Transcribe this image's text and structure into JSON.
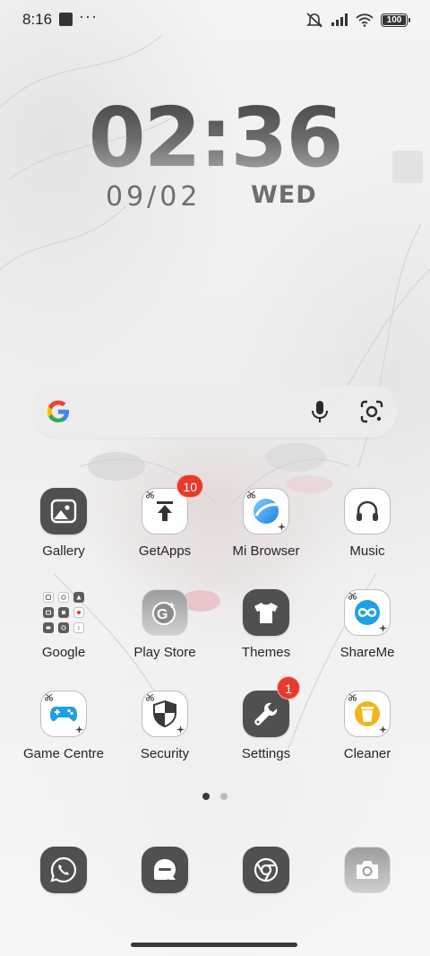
{
  "status_bar": {
    "time": "8:16",
    "battery_level": "100",
    "icons": [
      "notification-square-icon",
      "more-dots-icon",
      "muted-bell-icon",
      "signal-icon",
      "wifi-icon",
      "battery-icon"
    ]
  },
  "clock": {
    "time": "02:36",
    "date": "09/02",
    "day": "WED"
  },
  "search_bar": {
    "icons": [
      "google-logo-icon",
      "microphone-icon",
      "lens-camera-icon"
    ]
  },
  "apps": [
    {
      "label": "Gallery",
      "icon": "gallery-icon"
    },
    {
      "label": "GetApps",
      "icon": "getapps-icon",
      "badge": "10"
    },
    {
      "label": "Mi Browser",
      "icon": "mi-browser-icon"
    },
    {
      "label": "Music",
      "icon": "headphones-icon"
    },
    {
      "label": "Google",
      "icon": "google-folder-icon"
    },
    {
      "label": "Play Store",
      "icon": "play-store-icon"
    },
    {
      "label": "Themes",
      "icon": "tshirt-icon"
    },
    {
      "label": "ShareMe",
      "icon": "shareme-icon"
    },
    {
      "label": "Game Centre",
      "icon": "gamepad-icon"
    },
    {
      "label": "Security",
      "icon": "shield-icon"
    },
    {
      "label": "Settings",
      "icon": "wrench-icon",
      "badge": "1"
    },
    {
      "label": "Cleaner",
      "icon": "trash-can-icon"
    }
  ],
  "page_indicator": {
    "pages": 2,
    "active": 1
  },
  "dock": [
    "phone-icon",
    "messages-icon",
    "chrome-icon",
    "camera-icon"
  ],
  "colors": {
    "icon_dark": "#505050",
    "badge_red": "#e73a2c",
    "accent_blue": "#1fa0e6",
    "cleaner_yellow": "#f2b41d"
  }
}
